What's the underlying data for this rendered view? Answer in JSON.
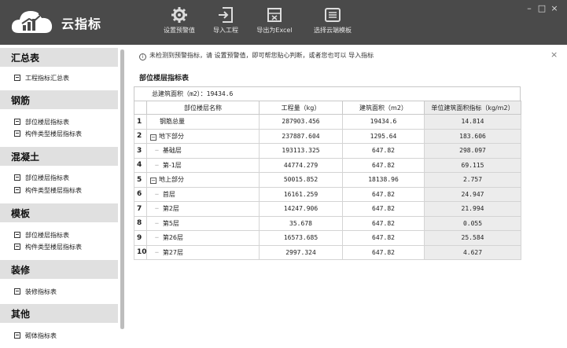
{
  "app": {
    "title": "云指标"
  },
  "toolbar": [
    {
      "id": "set-warning",
      "label": "设置预警值",
      "icon": "gear-icon"
    },
    {
      "id": "import-project",
      "label": "导入工程",
      "icon": "import-icon"
    },
    {
      "id": "export-excel",
      "label": "导出为Excel",
      "icon": "export-excel-icon"
    },
    {
      "id": "select-cloud-template",
      "label": "选择云端模板",
      "icon": "template-icon"
    }
  ],
  "window_controls": {
    "minimize": "–",
    "maximize": "□",
    "close": "×"
  },
  "sidebar": {
    "sections": [
      {
        "title": "汇总表",
        "items": [
          "工程指标汇总表"
        ]
      },
      {
        "title": "钢筋",
        "items": [
          "部位楼层指标表",
          "构件类型楼层指标表"
        ]
      },
      {
        "title": "混凝土",
        "items": [
          "部位楼层指标表",
          "构件类型楼层指标表"
        ]
      },
      {
        "title": "模板",
        "items": [
          "部位楼层指标表",
          "构件类型楼层指标表"
        ]
      },
      {
        "title": "装修",
        "items": [
          "装修指标表"
        ]
      },
      {
        "title": "其他",
        "items": [
          "砌体指标表"
        ]
      }
    ]
  },
  "main": {
    "notice": "未检测到预警指标，请 设置预警值，即可帮您贴心判断，或者您也可以 导入指标",
    "close": "×",
    "section_title": "部位楼层指标表",
    "total_area": "总建筑面积（m2）：19434.6",
    "table": {
      "columns": [
        "部位楼层名称",
        "工程量（kg）",
        "建筑面积（m2）",
        "单位建筑面积指标（kg/m2）"
      ],
      "rows": [
        {
          "num": "1",
          "name": "钢筋总量",
          "level": 0,
          "collapsible": false,
          "qty": "287903.456",
          "area": "19434.6",
          "index": "14.814"
        },
        {
          "num": "2",
          "name": "地下部分",
          "level": 0,
          "collapsible": true,
          "qty": "237887.604",
          "area": "1295.64",
          "index": "183.606"
        },
        {
          "num": "3",
          "name": "基础层",
          "level": 1,
          "collapsible": false,
          "qty": "193113.325",
          "area": "647.82",
          "index": "298.097"
        },
        {
          "num": "4",
          "name": "第-1层",
          "level": 1,
          "collapsible": false,
          "qty": "44774.279",
          "area": "647.82",
          "index": "69.115"
        },
        {
          "num": "5",
          "name": "地上部分",
          "level": 0,
          "collapsible": true,
          "qty": "50015.852",
          "area": "18138.96",
          "index": "2.757"
        },
        {
          "num": "6",
          "name": "首层",
          "level": 1,
          "collapsible": false,
          "qty": "16161.259",
          "area": "647.82",
          "index": "24.947"
        },
        {
          "num": "7",
          "name": "第2层",
          "level": 1,
          "collapsible": false,
          "qty": "14247.906",
          "area": "647.82",
          "index": "21.994"
        },
        {
          "num": "8",
          "name": "第5层",
          "level": 1,
          "collapsible": false,
          "qty": "35.678",
          "area": "647.82",
          "index": "0.055"
        },
        {
          "num": "9",
          "name": "第26层",
          "level": 1,
          "collapsible": false,
          "qty": "16573.685",
          "area": "647.82",
          "index": "25.584"
        },
        {
          "num": "10",
          "name": "第27层",
          "level": 1,
          "collapsible": false,
          "qty": "2997.324",
          "area": "647.82",
          "index": "4.627"
        }
      ]
    }
  }
}
